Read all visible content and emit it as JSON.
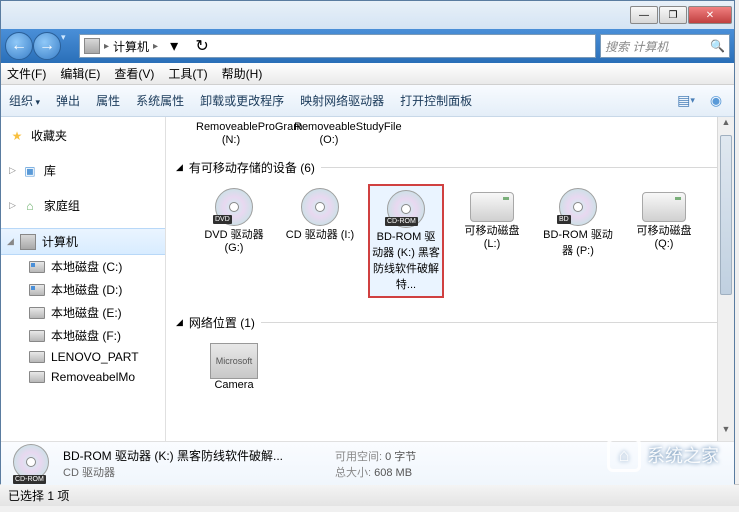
{
  "window": {
    "min": "—",
    "max": "❐",
    "close": "✕"
  },
  "nav": {
    "back": "←",
    "fwd": "→",
    "address_seg": "计算机",
    "search_placeholder": "搜索 计算机"
  },
  "menu": {
    "file": "文件(F)",
    "edit": "编辑(E)",
    "view": "查看(V)",
    "tools": "工具(T)",
    "help": "帮助(H)"
  },
  "toolbar": {
    "organize": "组织",
    "eject": "弹出",
    "properties": "属性",
    "sysprops": "系统属性",
    "uninstall": "卸载或更改程序",
    "mapdrive": "映射网络驱动器",
    "ctrlpanel": "打开控制面板"
  },
  "sidebar": {
    "favorites": "收藏夹",
    "libraries": "库",
    "homegroup": "家庭组",
    "computer": "计算机",
    "drives": [
      "本地磁盘 (C:)",
      "本地磁盘 (D:)",
      "本地磁盘 (E:)",
      "本地磁盘 (F:)",
      "LENOVO_PART",
      "RemoveabelMo"
    ]
  },
  "top_items": [
    {
      "label": "RemoveableProGram (N:)"
    },
    {
      "label": "RemoveableStudyFile (O:)"
    }
  ],
  "section_removable": "有可移动存储的设备 (6)",
  "section_network": "网络位置 (1)",
  "drives_row": [
    {
      "name": "DVD 驱动器 (G:)",
      "badge": "DVD",
      "type": "disc"
    },
    {
      "name": "CD 驱动器 (I:)",
      "badge": "",
      "type": "disc"
    },
    {
      "name": "BD-ROM 驱动器 (K:) 黑客防线软件破解特...",
      "badge": "CD-ROM",
      "type": "disc",
      "selected": true
    },
    {
      "name": "可移动磁盘 (L:)",
      "type": "remov"
    },
    {
      "name": "BD-ROM 驱动器 (P:)",
      "badge": "BD",
      "type": "disc"
    },
    {
      "name": "可移动磁盘 (Q:)",
      "type": "remov"
    }
  ],
  "network_item": "Camera",
  "details": {
    "title": "BD-ROM 驱动器 (K:) 黑客防线软件破解...",
    "subtitle": "CD 驱动器",
    "free_label": "可用空间:",
    "free_value": "0 字节",
    "total_label": "总大小:",
    "total_value": "608 MB",
    "badge": "CD-ROM"
  },
  "status": "已选择 1 项",
  "watermark": "系统之家"
}
